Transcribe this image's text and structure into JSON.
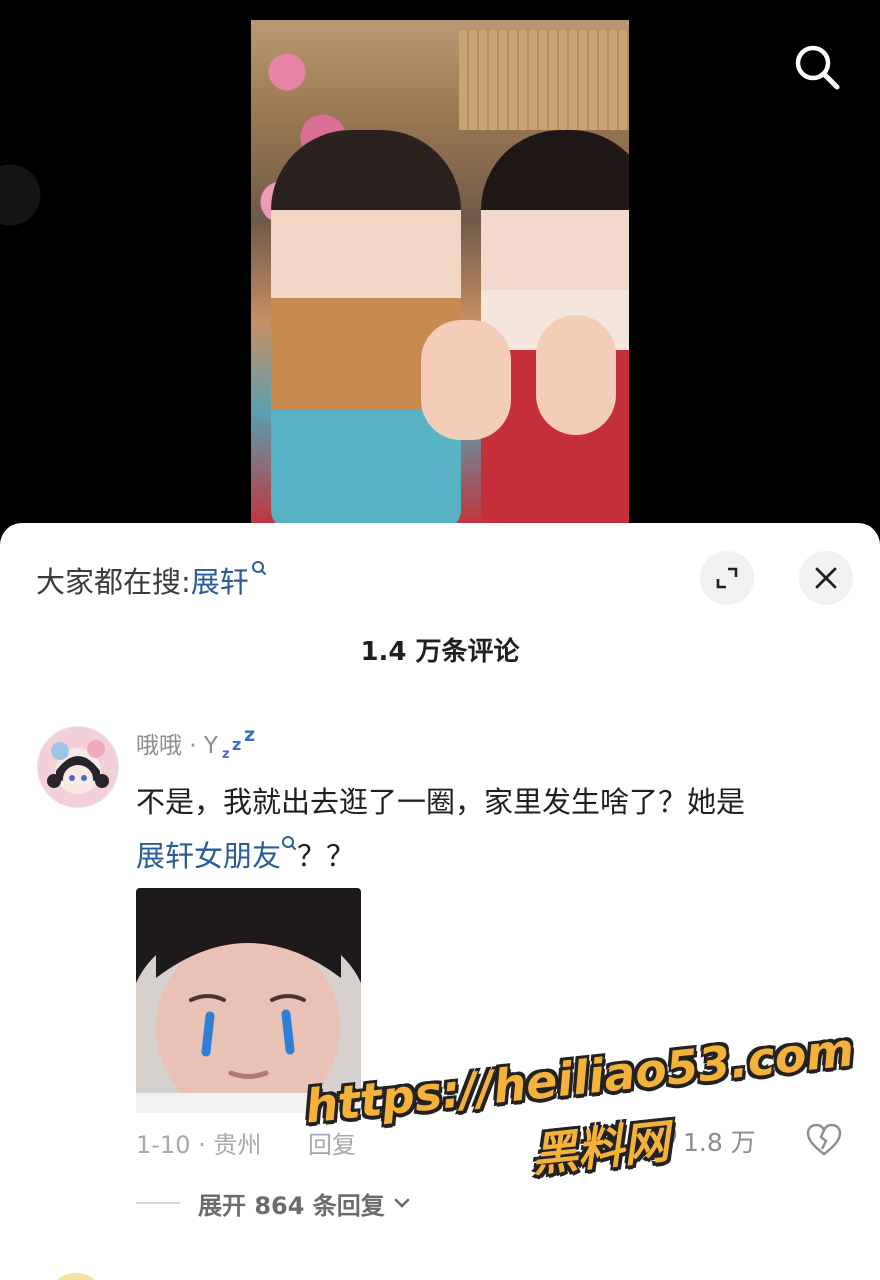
{
  "video": {
    "search_icon": "search-icon"
  },
  "sheet": {
    "search_prefix": "大家都在搜:",
    "search_term": "展轩",
    "expand_icon": "expand-icon",
    "close_icon": "close-icon",
    "comment_count": "1.4 万条评论"
  },
  "comment": {
    "username": "哦哦 · Y",
    "text": "不是，我就出去逛了一圈，家里发生啥了？她是",
    "link_text": "展轩女朋友",
    "text_suffix": "？？",
    "date_location": "1-10 · 贵州",
    "reply_label": "回复",
    "like_count": "1.8 万",
    "expand_replies": "展开 864 条回复"
  },
  "watermark": {
    "url": "https://heiliao53.com",
    "name": "黑料网"
  },
  "colors": {
    "link": "#2a5d98",
    "secondary_text": "#a8a8a8",
    "watermark": "#f4b23a"
  }
}
